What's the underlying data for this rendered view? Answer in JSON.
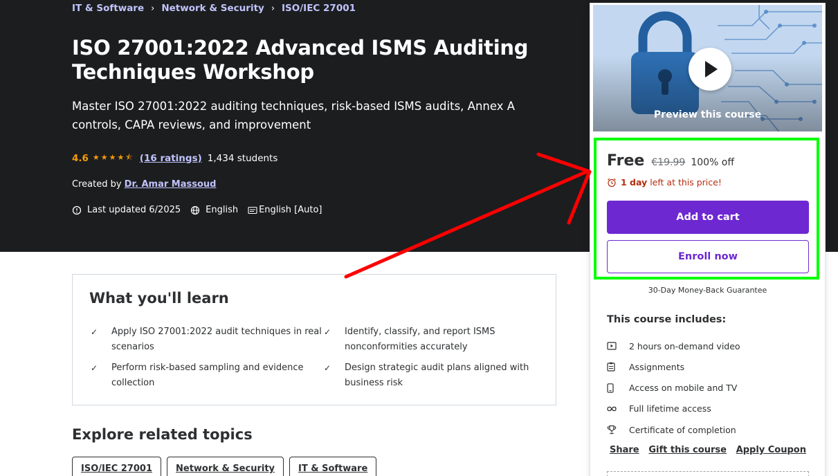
{
  "breadcrumb": [
    "IT & Software",
    "Network & Security",
    "ISO/IEC 27001"
  ],
  "course": {
    "title": "ISO 27001:2022 Advanced ISMS Auditing Techniques Workshop",
    "subtitle": "Master ISO 27001:2022 auditing techniques, risk-based ISMS audits, Annex A controls, CAPA reviews, and improvement",
    "rating": "4.6",
    "rating_value": 4.6,
    "ratings_count": "(16 ratings)",
    "students": "1,434 students",
    "created_by_label": "Created by",
    "instructor": "Dr. Amar Massoud",
    "last_updated": "Last updated 6/2025",
    "language": "English",
    "captions": "English [Auto]"
  },
  "learn": {
    "title": "What you'll learn",
    "items": [
      "Apply ISO 27001:2022 audit techniques in real scenarios",
      "Identify, classify, and report ISMS nonconformities accurately",
      "Perform risk-based sampling and evidence collection",
      "Design strategic audit plans aligned with business risk"
    ]
  },
  "related": {
    "title": "Explore related topics",
    "topics": [
      "ISO/IEC 27001",
      "Network & Security",
      "IT & Software"
    ]
  },
  "sidebar": {
    "preview_label": "Preview this course",
    "price": "Free",
    "original_price": "€19.99",
    "discount": "100% off",
    "timer_bold": "1 day",
    "timer_rest": "left at this price!",
    "add_to_cart": "Add to cart",
    "enroll_now": "Enroll now",
    "guarantee": "30-Day Money-Back Guarantee",
    "includes_title": "This course includes:",
    "includes": [
      {
        "icon": "video-icon",
        "text": "2 hours on-demand video"
      },
      {
        "icon": "assignment-icon",
        "text": "Assignments"
      },
      {
        "icon": "mobile-icon",
        "text": "Access on mobile and TV"
      },
      {
        "icon": "infinity-icon",
        "text": "Full lifetime access"
      },
      {
        "icon": "trophy-icon",
        "text": "Certificate of completion"
      }
    ],
    "links": {
      "share": "Share",
      "gift": "Gift this course",
      "coupon": "Apply Coupon"
    }
  },
  "colors": {
    "hero_bg": "#1c1d1f",
    "accent_purple": "#6d28d2",
    "link_lavender": "#c0c4fc",
    "star_orange": "#f69c08",
    "timer_red": "#b32d0f",
    "annotation_green": "#00ff00",
    "annotation_red": "#ff0000"
  }
}
